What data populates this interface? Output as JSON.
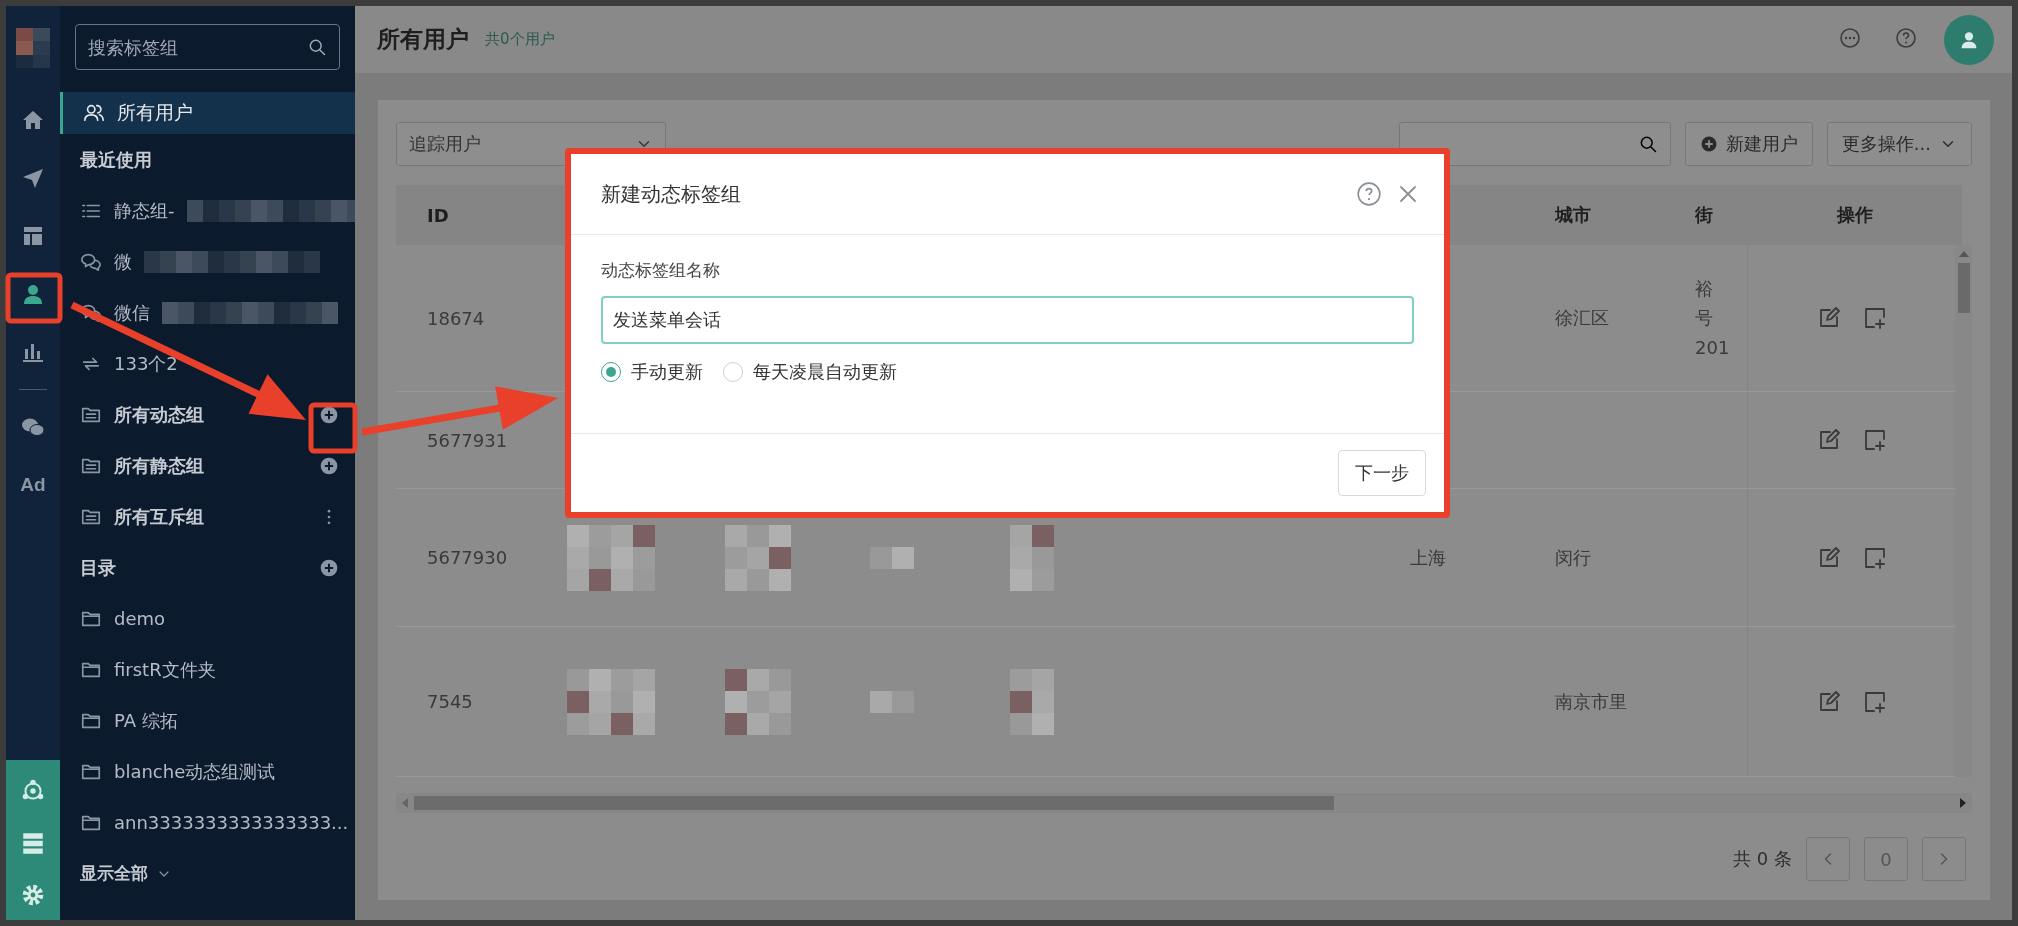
{
  "rail": {
    "items": [
      {
        "selected": false
      },
      {
        "selected": false
      },
      {
        "selected": false
      },
      {
        "selected": true
      },
      {
        "selected": false
      },
      {
        "selected": false
      },
      {
        "label": "Ad",
        "selected": false
      }
    ]
  },
  "sidebar": {
    "search": {
      "placeholder": "搜索标签组"
    },
    "all_users": {
      "label": "所有用户",
      "selected": true
    },
    "recent": {
      "title": "最近使用",
      "items": [
        {
          "kind": "list",
          "label": "静态组-",
          "redacted": true
        },
        {
          "kind": "chat",
          "label": "微",
          "redacted": true
        },
        {
          "kind": "chat",
          "label": "微信",
          "redacted": true
        },
        {
          "kind": "sync",
          "label": "133个2",
          "redacted": false
        }
      ]
    },
    "groups": [
      {
        "label": "所有动态组",
        "kind": "add"
      },
      {
        "label": "所有静态组",
        "kind": "add"
      },
      {
        "label": "所有互斥组",
        "kind": "more"
      }
    ],
    "catalog": {
      "title": "目录",
      "folders": [
        "demo",
        "firstR文件夹",
        "PA 综拓",
        "blanche动态组测试",
        "ann3333333333333333..."
      ]
    },
    "show_all": "显示全部"
  },
  "header": {
    "title": "所有用户",
    "count": "共0个用户"
  },
  "toolbar": {
    "filter": {
      "value": "追踪用户"
    },
    "new_button": "新建用户",
    "more_button": "更多操作..."
  },
  "table": {
    "columns": {
      "id": "ID",
      "city": "城市",
      "street": "街",
      "actions": "操作"
    },
    "rows": [
      {
        "id": "18674",
        "city": "徐汇区",
        "street": [
          "裕",
          "号",
          "201"
        ],
        "redacted": false
      },
      {
        "id": "5677931",
        "redacted": false
      },
      {
        "id": "5677930",
        "province": "上海",
        "city": "闵行",
        "redacted": true
      },
      {
        "id": "7545",
        "city": "南京市里",
        "redacted": true
      }
    ]
  },
  "pagination": {
    "total": "共 0 条",
    "page": "0"
  },
  "dialog": {
    "title": "新建动态标签组",
    "name_label": "动态标签组名称",
    "name_value": "发送菜单会话",
    "update_modes": [
      {
        "label": "手动更新",
        "selected": true
      },
      {
        "label": "每天凌晨自动更新",
        "selected": false
      }
    ],
    "next_button": "下一步"
  }
}
